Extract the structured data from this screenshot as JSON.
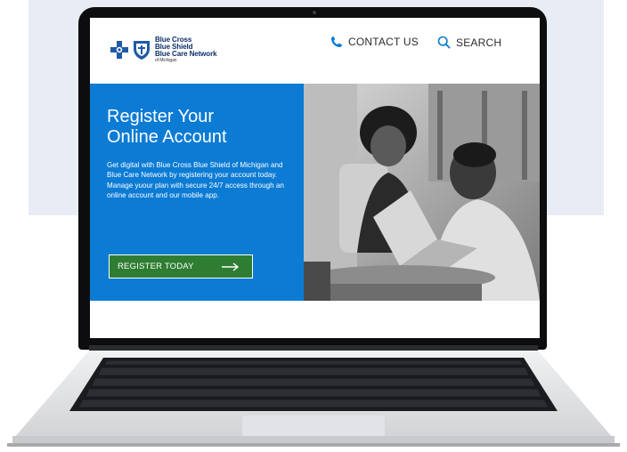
{
  "brand": {
    "line1": "Blue Cross",
    "line2": "Blue Shield",
    "line3": "Blue Care Network",
    "line4": "of Michigan",
    "color": "#0b2f6b"
  },
  "nav": {
    "contact_label": "CONTACT US",
    "search_label": "SEARCH",
    "icon_color": "#0c7bd4"
  },
  "hero": {
    "title_line1": "Register Your",
    "title_line2": "Online Account",
    "body": "Get digital with Blue Cross Blue Shield of Michigan and Blue Care Network by registering your account today. Manage yuour plan with secure 24/7 access through an online account and our mobile app.",
    "button_label": "REGISTER TODAY",
    "background_color": "#0c7bd4",
    "button_color": "#2e7d32"
  },
  "icons": {
    "phone": "phone-icon",
    "search": "search-icon",
    "arrow": "arrow-right-icon",
    "logo": "bcbs-logo"
  }
}
